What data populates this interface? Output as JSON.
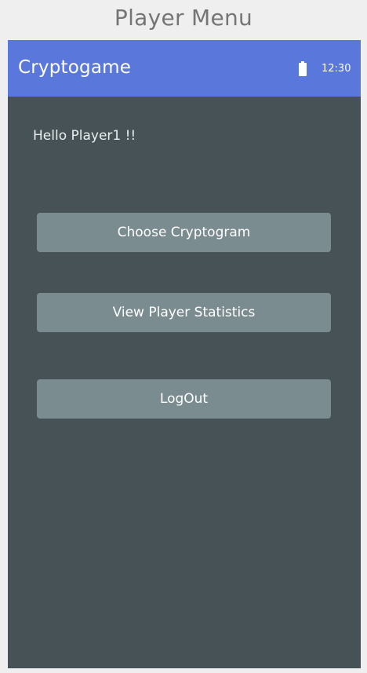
{
  "caption": "Player Menu",
  "app_bar": {
    "title": "Cryptogame",
    "battery_icon": "battery-icon",
    "time": "12:30",
    "color": "#5a78dc"
  },
  "content": {
    "background": "#475256",
    "greeting": "Hello Player1 !!",
    "buttons": [
      {
        "label": "Choose Cryptogram"
      },
      {
        "label": "View Player Statistics"
      },
      {
        "label": "LogOut"
      }
    ],
    "button_color": "#7b8c90"
  }
}
